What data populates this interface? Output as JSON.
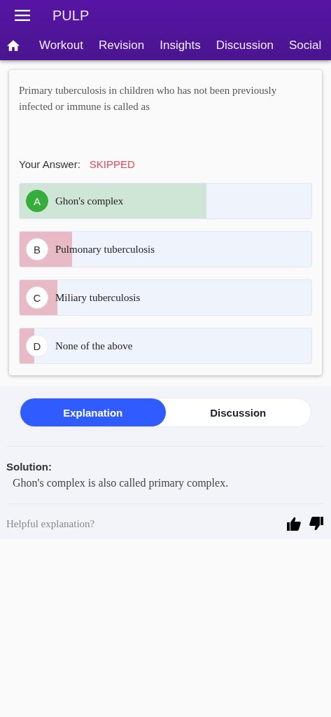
{
  "app_bar": {
    "title": "PULP"
  },
  "nav_tabs": [
    "Workout",
    "Revision",
    "Insights",
    "Discussion",
    "Social"
  ],
  "question": {
    "text": "Primary tuberculosis in children who has not been previously infected or immune is called as",
    "answer_label": "Your Answer:",
    "answer_value": "SKIPPED",
    "options": [
      {
        "letter": "A",
        "text": "Ghon's complex",
        "correct": true,
        "level": 0.64
      },
      {
        "letter": "B",
        "text": "Pulmonary tuberculosis",
        "correct": false,
        "level": 0.18
      },
      {
        "letter": "C",
        "text": "Miliary tuberculosis",
        "correct": false,
        "level": 0.13
      },
      {
        "letter": "D",
        "text": "None of the above",
        "correct": false,
        "level": 0.05
      }
    ]
  },
  "segments": [
    {
      "label": "Explanation",
      "selected": true
    },
    {
      "label": "Discussion",
      "selected": false
    }
  ],
  "solution": {
    "heading": "Solution:",
    "text": "Ghon's complex is also called primary complex."
  },
  "feedback": {
    "prompt": "Helpful explanation?"
  }
}
